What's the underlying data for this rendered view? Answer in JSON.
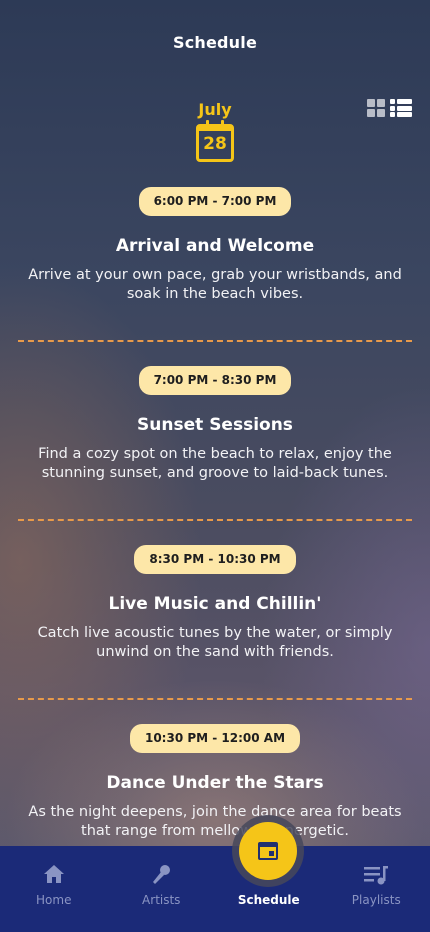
{
  "header": {
    "title": "Schedule"
  },
  "date": {
    "month": "July",
    "day": "28"
  },
  "events": [
    {
      "time": "6:00 PM  - 7:00 PM",
      "title": "Arrival and Welcome",
      "description": "Arrive at your own pace, grab your wristbands, and soak in the beach vibes."
    },
    {
      "time": "7:00 PM - 8:30 PM",
      "title": "Sunset Sessions",
      "description": "Find a cozy spot on the beach to relax, enjoy the stunning sunset, and groove to laid-back tunes."
    },
    {
      "time": "8:30 PM - 10:30 PM",
      "title": "Live Music and Chillin'",
      "description": "Catch live acoustic tunes by the water, or simply unwind on the sand with friends."
    },
    {
      "time": "10:30 PM - 12:00 AM",
      "title": "Dance Under the Stars",
      "description": "As the night deepens, join the dance area for beats that range from mellow to energetic."
    }
  ],
  "tabs": [
    {
      "label": "Home",
      "icon": "home-icon"
    },
    {
      "label": "Artists",
      "icon": "microphone-icon"
    },
    {
      "label": "Schedule",
      "icon": "calendar-icon",
      "active": true
    },
    {
      "label": "Playlists",
      "icon": "playlist-icon"
    }
  ],
  "colors": {
    "accent": "#f5c518",
    "pill": "#fde7a8",
    "divider": "#e89a4a",
    "tabbar": "#1b2a78"
  }
}
